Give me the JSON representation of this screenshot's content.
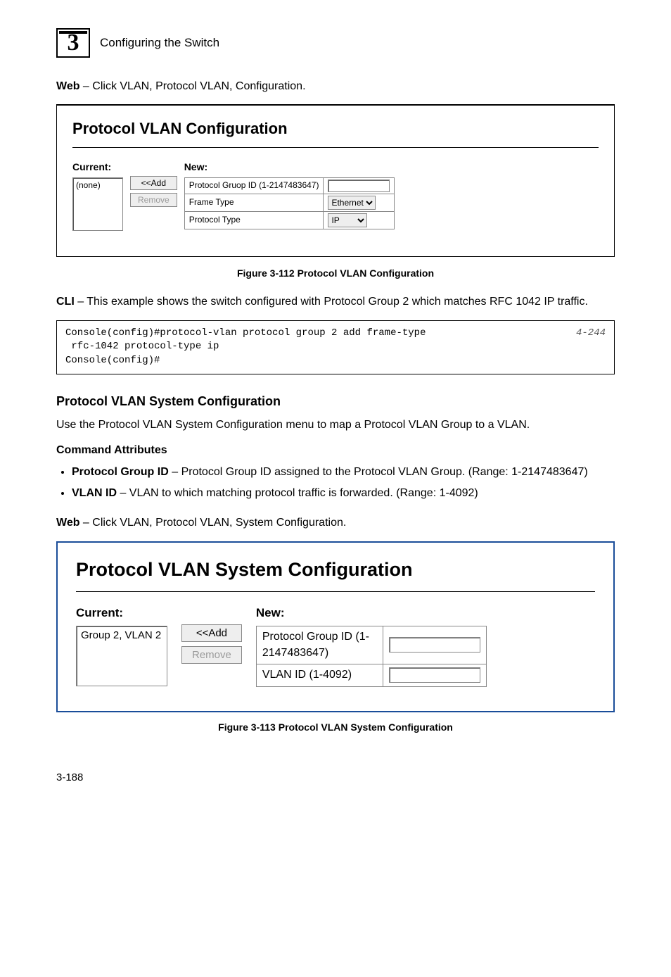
{
  "header": {
    "chapter_number": "3",
    "chapter_title": "Configuring the Switch"
  },
  "intro_web": {
    "prefix": "Web",
    "text": " – Click VLAN, Protocol VLAN, Configuration."
  },
  "figure1": {
    "panel_title": "Protocol VLAN Configuration",
    "current_label": "Current:",
    "current_value": "(none)",
    "new_label": "New:",
    "btn_add": "<<Add",
    "btn_remove": "Remove",
    "row_group_id": "Protocol Gruop ID (1-2147483647)",
    "row_frame_type": "Frame Type",
    "row_protocol_type": "Protocol Type",
    "frame_type_value": "Ethernet",
    "protocol_type_value": "IP",
    "caption": "Figure 3-112  Protocol VLAN Configuration"
  },
  "cli_intro": {
    "prefix": "CLI",
    "text": " – This example shows the switch configured with Protocol Group 2 which matches RFC 1042 IP traffic."
  },
  "cli": {
    "lines": "Console(config)#protocol-vlan protocol group 2 add frame-type\n rfc-1042 protocol-type ip\nConsole(config)#",
    "ref": "4-244"
  },
  "section": {
    "heading": "Protocol VLAN System Configuration",
    "desc": "Use the Protocol VLAN System Configuration menu to map a Protocol VLAN Group to a VLAN.",
    "attrs_heading": "Command Attributes",
    "attr1_label": "Protocol Group ID",
    "attr1_text": " – Protocol Group ID assigned to the Protocol VLAN Group. (Range: 1-2147483647)",
    "attr2_label": "VLAN ID",
    "attr2_text": " – VLAN to which matching protocol traffic is forwarded. (Range: 1-4092)"
  },
  "intro_web2": {
    "prefix": "Web",
    "text": " – Click VLAN, Protocol VLAN, System Configuration."
  },
  "figure2": {
    "panel_title": "Protocol VLAN System Configuration",
    "current_label": "Current:",
    "current_value": "Group 2, VLAN 2",
    "new_label": "New:",
    "btn_add": "<<Add",
    "btn_remove": "Remove",
    "row_group_id": "Protocol Group ID (1-2147483647)",
    "row_vlan_id": "VLAN ID (1-4092)",
    "caption": "Figure 3-113  Protocol VLAN System Configuration"
  },
  "page_number": "3-188"
}
